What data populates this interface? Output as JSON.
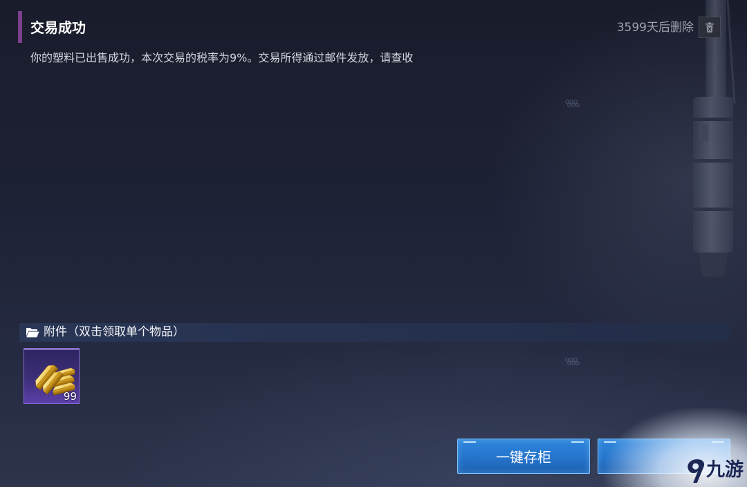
{
  "mail": {
    "title": "交易成功",
    "expiry": "3599天后删除",
    "delete_icon": "trash-icon",
    "body": "你的塑料已出售成功，本次交易的税率为9%。交易所得通过邮件发放，请查收"
  },
  "attachments": {
    "icon": "folder-open-icon",
    "header": "附件（双击领取单个物品）",
    "items": [
      {
        "icon": "gold-bars-icon",
        "count": "99"
      }
    ]
  },
  "actions": {
    "store_all_label": "一键存柜"
  },
  "watermark": {
    "logo_icon": "jiuyou-logo-icon",
    "text": "九游"
  },
  "colors": {
    "background": "#1e2236",
    "title_accent": "#7b3f8c",
    "button_fill": "#2574cc",
    "button_border": "#7cc4ff",
    "item_rarity": "#8a6ad6"
  }
}
